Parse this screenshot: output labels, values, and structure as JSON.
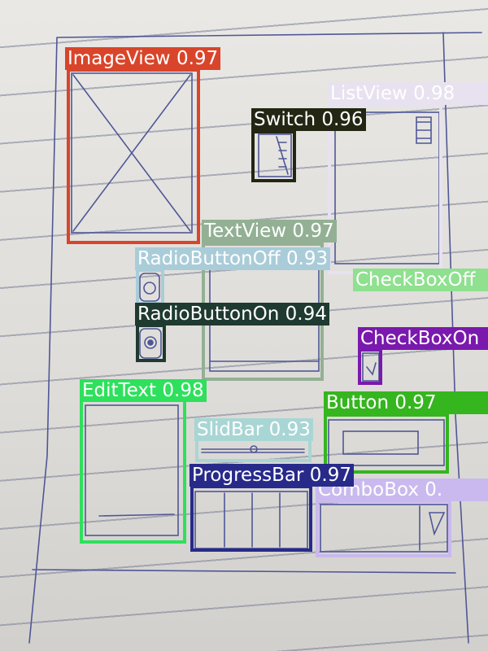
{
  "detections": [
    {
      "label": "ImageView",
      "score": "0.97",
      "color": "#d9452a",
      "text_color": "#ffffff"
    },
    {
      "label": "ListView",
      "score": "0.98",
      "color": "#e8e1ef",
      "text_color": "#ffffff"
    },
    {
      "label": "Switch",
      "score": "0.96",
      "color": "#232612",
      "text_color": "#ffffff"
    },
    {
      "label": "TextView",
      "score": "0.97",
      "color": "#93b094",
      "text_color": "#ffffff"
    },
    {
      "label": "RadioButtonOff",
      "score": "0.93",
      "color": "#a9ccd8",
      "text_color": "#ffffff"
    },
    {
      "label": "CheckBoxOff",
      "score": "",
      "color": "#8fe08f",
      "text_color": "#ffffff"
    },
    {
      "label": "RadioButtonOn",
      "score": "0.94",
      "color": "#1f3a30",
      "text_color": "#ffffff"
    },
    {
      "label": "CheckBoxOn",
      "score": "",
      "color": "#7a19ad",
      "text_color": "#ffffff"
    },
    {
      "label": "EditText",
      "score": "0.98",
      "color": "#2ee05c",
      "text_color": "#ffffff"
    },
    {
      "label": "Button",
      "score": "0.97",
      "color": "#35b51e",
      "text_color": "#ffffff"
    },
    {
      "label": "SlidBar",
      "score": "0.93",
      "color": "#a8d6d4",
      "text_color": "#ffffff"
    },
    {
      "label": "ProgressBar",
      "score": "0.97",
      "color": "#282a8a",
      "text_color": "#ffffff"
    },
    {
      "label": "ComboBox",
      "score": "0.",
      "color": "#c9b9ee",
      "text_color": "#ffffff"
    }
  ]
}
